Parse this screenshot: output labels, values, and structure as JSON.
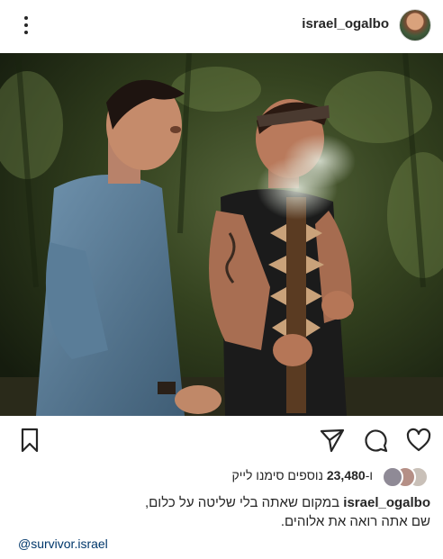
{
  "post": {
    "username": "israel_ogalbo",
    "photo_alt": "",
    "likes": {
      "prefix": "ו-",
      "count": "23,480",
      "suffix": " נוספים סימנו לייק"
    },
    "caption": {
      "username": "israel_ogalbo",
      "line1": " במקום שאתה בלי שליטה על כלום,",
      "line2": "שם אתה רואה את אלוהים."
    },
    "mention": "@survivor.israel"
  },
  "icons": {
    "more": "more-options-icon",
    "heart": "heart-icon",
    "comment": "comment-icon",
    "share": "share-icon",
    "save": "bookmark-icon"
  },
  "colors": {
    "text": "#262626",
    "mention": "#00376b",
    "background": "#ffffff"
  }
}
